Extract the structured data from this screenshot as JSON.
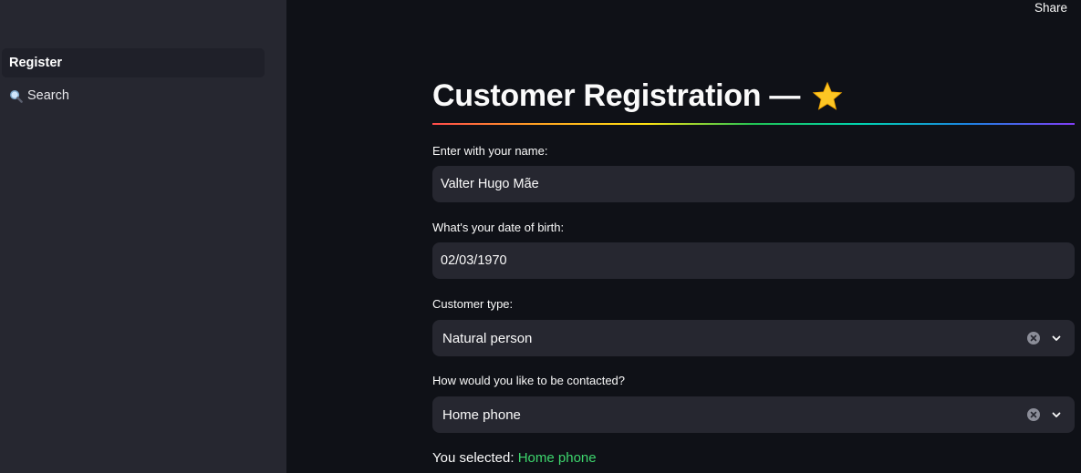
{
  "header": {
    "share_label": "Share"
  },
  "sidebar": {
    "items": [
      {
        "label": "Register",
        "icon": ""
      },
      {
        "label": "Search",
        "icon": "magnifier-icon"
      }
    ]
  },
  "main": {
    "title": "Customer Registration —",
    "title_icon": "star-icon",
    "name": {
      "label": "Enter with your name:",
      "value": "Valter Hugo Mãe"
    },
    "birth": {
      "label": "What's your date of birth:",
      "value": "02/03/1970"
    },
    "customer_type": {
      "label": "Customer type:",
      "value": "Natural person"
    },
    "contact": {
      "label": "How would you like to be contacted?",
      "value": "Home phone"
    },
    "selected": {
      "prefix": "You selected:",
      "value": "Home phone"
    }
  },
  "colors": {
    "background": "#0f1117",
    "sidebar": "#262730",
    "input": "#262730",
    "accent_green": "#3dd56d",
    "star": "#fcc624"
  }
}
